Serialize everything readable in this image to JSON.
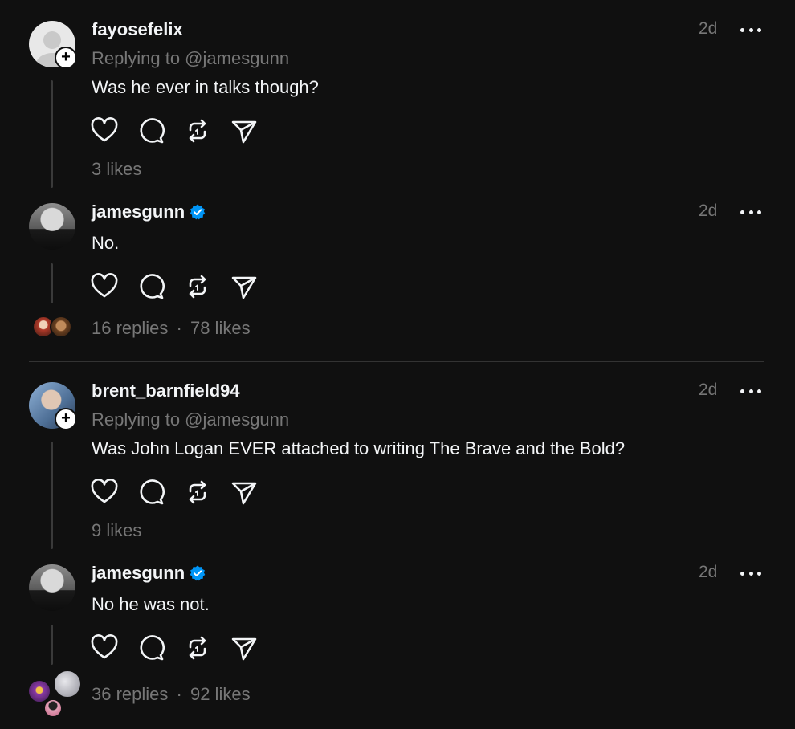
{
  "posts": [
    {
      "username": "fayosefelix",
      "replying_to": "Replying to @jamesgunn",
      "text": "Was he ever in talks though?",
      "time": "2d",
      "stats": "3 likes",
      "verified": false
    },
    {
      "username": "jamesgunn",
      "text": "No.",
      "time": "2d",
      "replies": "16 replies",
      "separator": "·",
      "likes": "78 likes",
      "verified": true
    },
    {
      "username": "brent_barnfield94",
      "replying_to": "Replying to @jamesgunn",
      "text": "Was John Logan EVER attached to writing The Brave and the Bold?",
      "time": "2d",
      "stats": "9 likes",
      "verified": false
    },
    {
      "username": "jamesgunn",
      "text": "No he was not.",
      "time": "2d",
      "replies": "36 replies",
      "separator": "·",
      "likes": "92 likes",
      "verified": true
    }
  ],
  "icons": {
    "like": "heart-icon",
    "reply": "comment-icon",
    "repost": "repost-icon",
    "share": "send-icon",
    "more": "more-icon",
    "follow": "plus-icon",
    "verified": "verified-badge-icon"
  },
  "colors": {
    "background": "#101010",
    "primary_text": "#f3f5f7",
    "secondary_text": "#777777",
    "verified": "#0095f6",
    "thread_line": "#3a3a3a"
  }
}
